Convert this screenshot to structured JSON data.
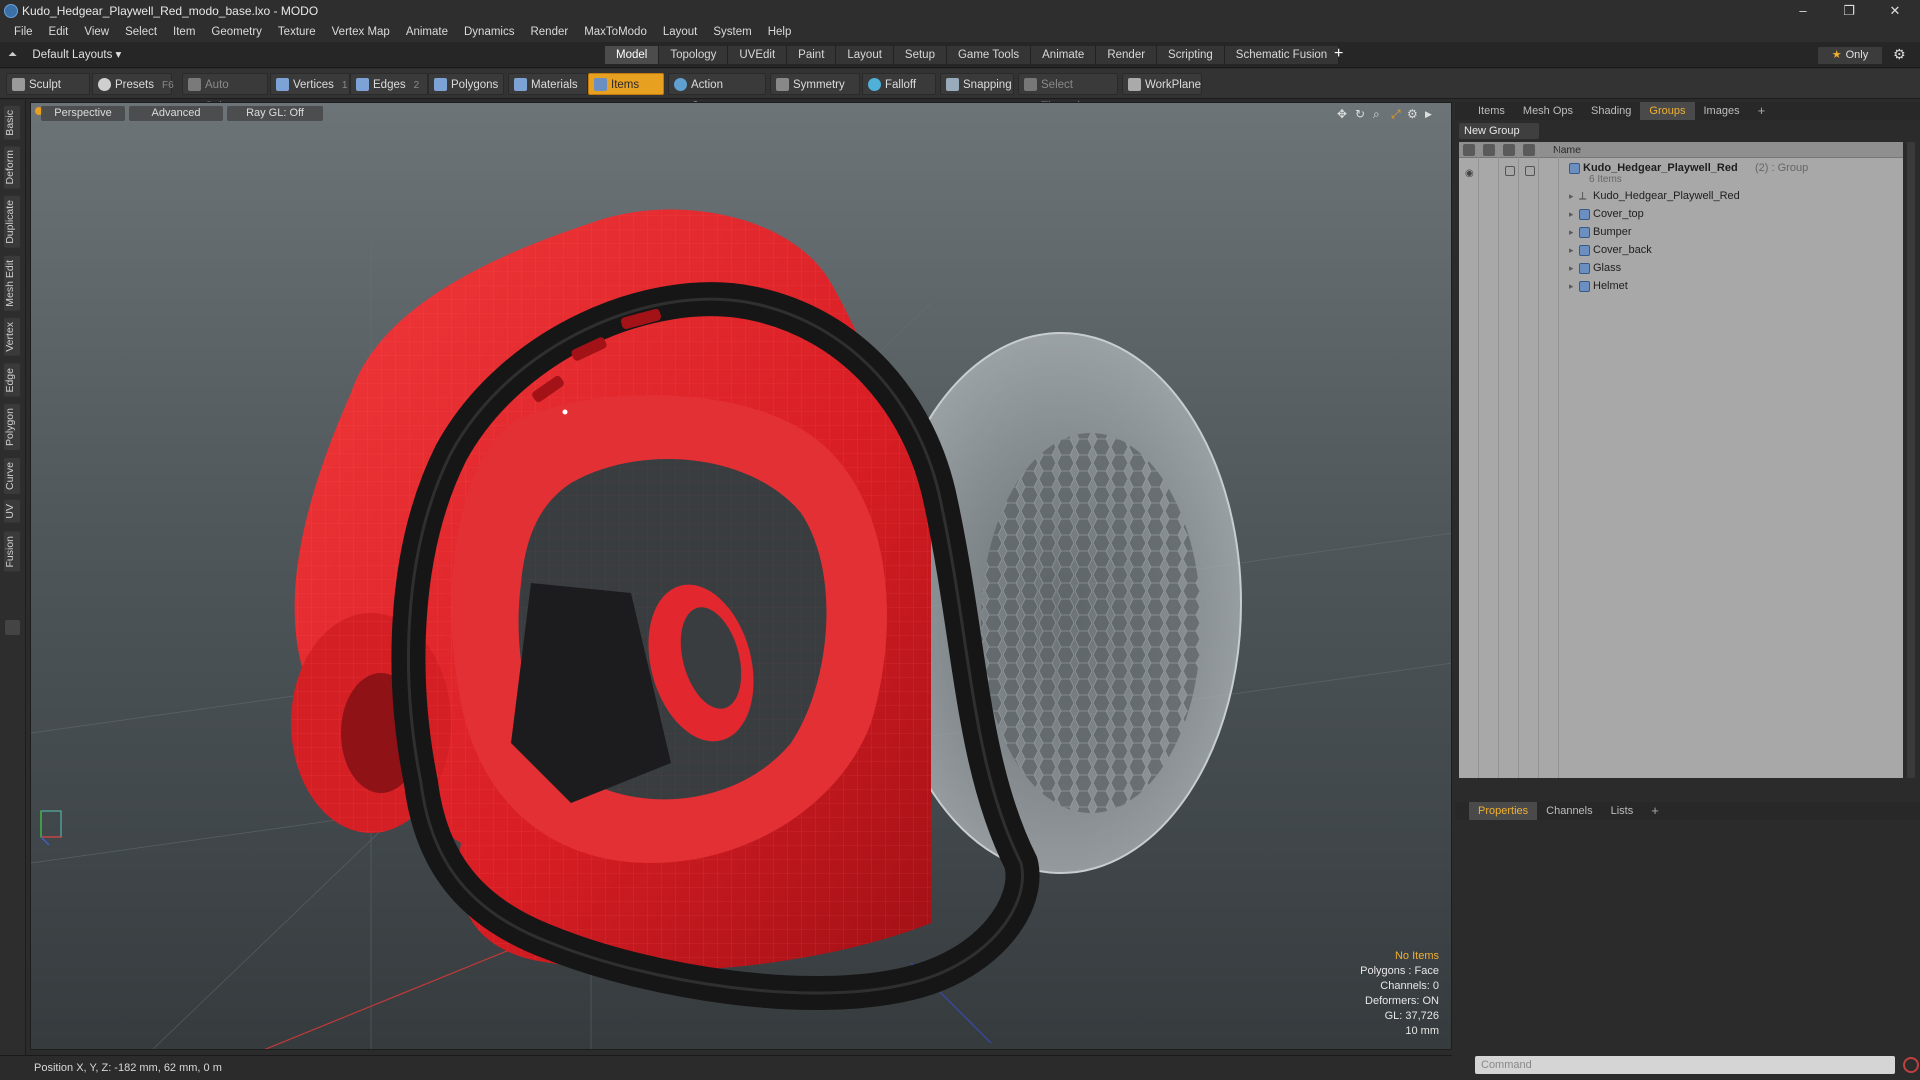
{
  "window": {
    "title": "Kudo_Hedgear_Playwell_Red_modo_base.lxo - MODO",
    "controls": [
      "–",
      "❐",
      "✕"
    ]
  },
  "menu": [
    "File",
    "Edit",
    "View",
    "Select",
    "Item",
    "Geometry",
    "Texture",
    "Vertex Map",
    "Animate",
    "Dynamics",
    "Render",
    "MaxToModo",
    "Layout",
    "System",
    "Help"
  ],
  "layouts": {
    "selector": "Default Layouts ▾",
    "tabs": [
      "Model",
      "Topology",
      "UVEdit",
      "Paint",
      "Layout",
      "Setup",
      "Game Tools",
      "Animate",
      "Render",
      "Scripting",
      "Schematic Fusion"
    ],
    "active_tab": "Model",
    "plus": "+",
    "only_label": "Only"
  },
  "toolbar": {
    "sculpt": "Sculpt",
    "presets": "Presets",
    "presets_shortcut": "F6",
    "auto_select": "Auto Select",
    "vertices": "Vertices",
    "vertices_count": "1",
    "edges": "Edges",
    "edges_count": "2",
    "polygons": "Polygons",
    "materials": "Materials",
    "items": "Items",
    "action_center": "Action Center",
    "symmetry": "Symmetry",
    "falloff": "Falloff",
    "snapping": "Snapping",
    "select_through": "Select Through",
    "workplane": "WorkPlane"
  },
  "left_tabs": [
    "Basic",
    "Deform",
    "Duplicate",
    "Mesh Edit",
    "Vertex",
    "Edge",
    "Polygon",
    "Curve",
    "UV",
    "Fusion"
  ],
  "viewport": {
    "view": "Perspective",
    "mode": "Advanced",
    "raygl": "Ray GL: Off",
    "hud": {
      "items": "No Items",
      "polygons": "Polygons : Face",
      "channels": "Channels: 0",
      "deformers": "Deformers: ON",
      "gl": "GL: 37,726",
      "scale": "10 mm"
    }
  },
  "status": {
    "position": "Position X, Y, Z:  -182 mm, 62 mm, 0 m"
  },
  "groups_panel": {
    "tabs": [
      "Items",
      "Mesh Ops",
      "Shading",
      "Groups",
      "Images",
      "+"
    ],
    "active_tab": "Groups",
    "new_group": "New Group",
    "name_header": "Name",
    "group": {
      "name": "Kudo_Hedgear_Playwell_Red",
      "suffix": "(2) : Group",
      "count": "6 Items"
    },
    "items": [
      "Kudo_Hedgear_Playwell_Red",
      "Cover_top",
      "Bumper",
      "Cover_back",
      "Glass",
      "Helmet"
    ]
  },
  "props_panel": {
    "tabs": [
      "Properties",
      "Channels",
      "Lists",
      "+"
    ],
    "active_tab": "Properties"
  },
  "command": {
    "placeholder": "Command"
  },
  "colors": {
    "accent": "#f0b030",
    "helmet_red": "#e8242a",
    "strap_black": "#1a1a1a"
  }
}
